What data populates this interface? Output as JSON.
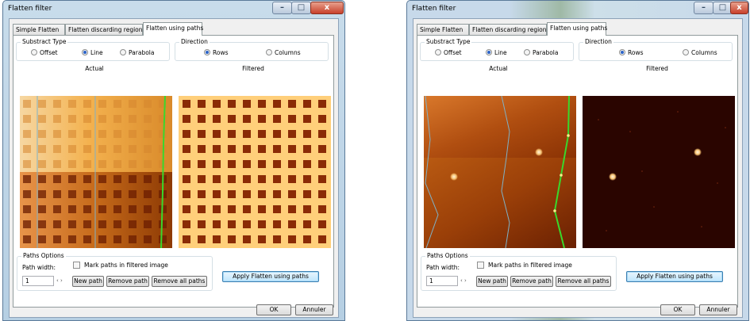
{
  "windows": [
    {
      "title": "Flatten filter",
      "controls": {
        "minimize": "–",
        "maximize": "□",
        "close": "x"
      },
      "tabs": [
        "Simple Flatten",
        "Flatten discarding regions",
        "Flatten using paths"
      ],
      "active_tab": 2,
      "substract_type": {
        "label": "Substract Type",
        "options": [
          "Offset",
          "Line",
          "Parabola"
        ],
        "selected": "Line"
      },
      "direction": {
        "label": "Direction",
        "options": [
          "Rows",
          "Columns"
        ],
        "selected": "Rows"
      },
      "actual_caption": "Actual",
      "filtered_caption": "Filtered",
      "paths_options": {
        "label": "Paths Options",
        "path_width_label": "Path width:",
        "path_width_value": "1",
        "spinner": "‹ ›",
        "mark_paths_label": "Mark paths in filtered image",
        "mark_paths_checked": false,
        "new_path": "New path",
        "remove_path": "Remove path",
        "remove_all_paths": "Remove all paths"
      },
      "apply_button": "Apply Flatten using paths",
      "ok": "OK",
      "cancel": "Annuler"
    },
    {
      "title": "Flatten filter",
      "controls": {
        "minimize": "–",
        "maximize": "□",
        "close": "x"
      },
      "tabs": [
        "Simple Flatten",
        "Flatten discarding regions",
        "Flatten using paths"
      ],
      "active_tab": 2,
      "substract_type": {
        "label": "Substract Type",
        "options": [
          "Offset",
          "Line",
          "Parabola"
        ],
        "selected": "Line"
      },
      "direction": {
        "label": "Direction",
        "options": [
          "Rows",
          "Columns"
        ],
        "selected": "Rows"
      },
      "actual_caption": "Actual",
      "filtered_caption": "Filtered",
      "paths_options": {
        "label": "Paths Options",
        "path_width_label": "Path width:",
        "path_width_value": "1",
        "spinner": "‹ ›",
        "mark_paths_label": "Mark paths in filtered image",
        "mark_paths_checked": false,
        "new_path": "New path",
        "remove_path": "Remove path",
        "remove_all_paths": "Remove all paths"
      },
      "apply_button": "Apply Flatten using paths",
      "ok": "OK",
      "cancel": "Annuler"
    }
  ],
  "colors": {
    "path_green": "#39d82c",
    "path_blue": "#7fb2c8",
    "grid_hole": "#8a2b06",
    "tile_light": "#ffcf7a",
    "afm_dark": "#2a0500"
  }
}
